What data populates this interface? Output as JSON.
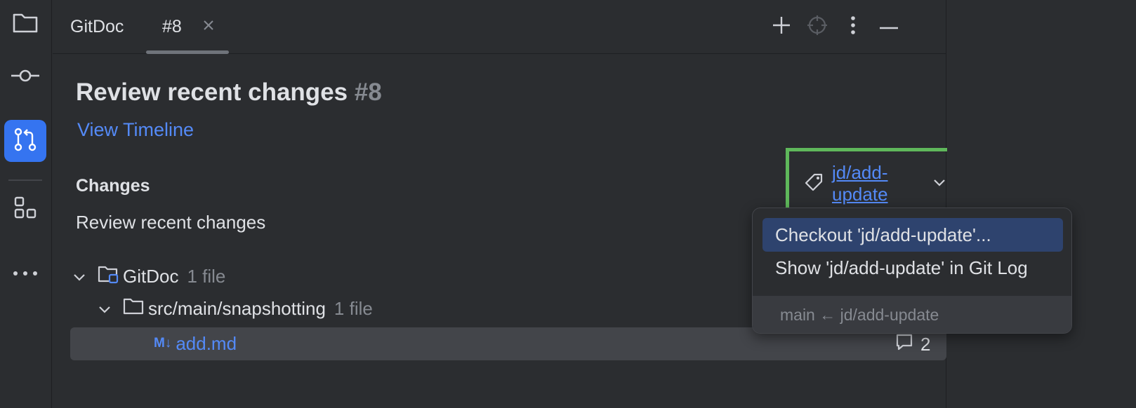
{
  "strip": {
    "items": [
      {
        "icon": "folder-icon"
      },
      {
        "icon": "commit-icon"
      },
      {
        "icon": "pull-requests-icon",
        "active": true
      },
      {
        "icon": "structure-icon"
      },
      {
        "icon": "more-icon"
      }
    ]
  },
  "tabs": {
    "items": [
      {
        "label": "GitDoc"
      },
      {
        "label": "#8",
        "selected": true
      }
    ],
    "close_glyph": "×"
  },
  "toolbar": {
    "add_glyph": "+",
    "minimize_glyph": "—"
  },
  "review": {
    "title": "Review recent changes",
    "number": "#8",
    "timeline_link": "View Timeline",
    "section_label": "Changes",
    "description": "Review recent changes",
    "branch": "jd/add-update"
  },
  "tree": {
    "root": {
      "name": "GitDoc",
      "count": "1 file"
    },
    "folder": {
      "name": "src/main/snapshotting",
      "count": "1 file"
    },
    "file": {
      "badge": "M↓",
      "name": "add.md",
      "comments": "2"
    }
  },
  "popup": {
    "items": [
      {
        "label": "Checkout 'jd/add-update'...",
        "selected": true
      },
      {
        "label": "Show 'jd/add-update' in Git Log"
      }
    ],
    "footer": "main ← jd/add-update"
  },
  "colors": {
    "accent": "#3574f0",
    "link": "#548af7",
    "highlight": "#5fb85b",
    "selection": "#2e436e"
  }
}
